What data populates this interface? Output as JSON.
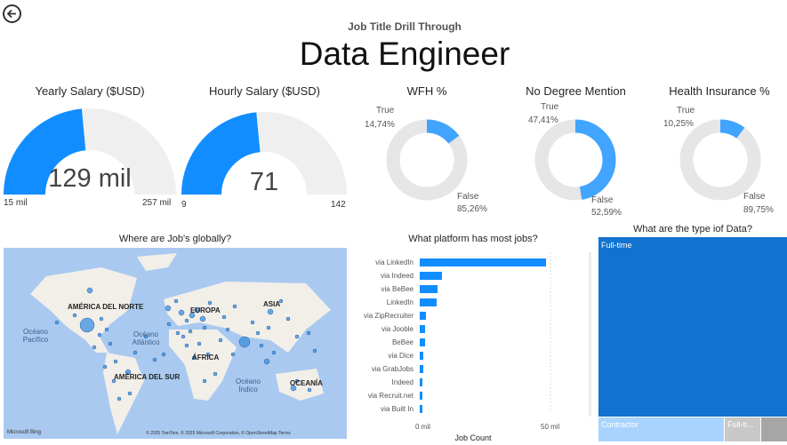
{
  "header": {
    "back_icon": "back-arrow-icon",
    "subtitle": "Job Title Drill Through",
    "title": "Data Engineer"
  },
  "gauges": [
    {
      "title": "Yearly Salary ($USD)",
      "value_label": "129 mil",
      "min_label": "15 mil",
      "max_label": "257 mil",
      "fraction": 0.47,
      "color": "#118DFF"
    },
    {
      "title": "Hourly Salary ($USD)",
      "value_label": "71",
      "min_label": "9",
      "max_label": "142",
      "fraction": 0.47,
      "color": "#118DFF"
    }
  ],
  "donuts": [
    {
      "title": "WFH %",
      "true_label": "True",
      "true_value": "14,74%",
      "false_label": "False",
      "false_value": "85,26%",
      "true_fraction": 0.1474
    },
    {
      "title": "No Degree Mention",
      "true_label": "True",
      "true_value": "47,41%",
      "false_label": "False",
      "false_value": "52,59%",
      "true_fraction": 0.4741
    },
    {
      "title": "Health Insurance %",
      "true_label": "True",
      "true_value": "10,25%",
      "false_label": "False",
      "false_value": "89,75%",
      "true_fraction": 0.1025
    }
  ],
  "map": {
    "title": "Where are Job's globally?",
    "continents": [
      "AMÉRICA DEL NORTE",
      "EUROPA",
      "ASIA",
      "ÁFRICA",
      "AMÉRICA DEL SUR",
      "OCEANÍA"
    ],
    "oceans": [
      "Océano Pacífico",
      "Océano Atlántico",
      "Océano Índico"
    ],
    "logo_text": "Microsoft Bing",
    "attribution": "© 2025 TomTom, © 2025 Microsoft Corporation, © OpenStreetMap  Terms"
  },
  "chart_data": {
    "type": "bar",
    "title": "What platform has most jobs?",
    "xlabel": "Job Count",
    "x_ticks": [
      "0 mil",
      "50 mil"
    ],
    "xlim": [
      0,
      60
    ],
    "categories": [
      "via LinkedIn",
      "via Indeed",
      "via BeBee",
      "LinkedIn",
      "via ZipRecruiter",
      "via Jooble",
      "BeBee",
      "via Dice",
      "via GrabJobs",
      "Indeed",
      "via Recruit.net",
      "via Built In"
    ],
    "values": [
      49,
      8.5,
      7,
      6.5,
      2.5,
      2.2,
      2.2,
      1.5,
      1.3,
      1.2,
      1.0,
      1.0
    ],
    "color": "#118DFF"
  },
  "treemap": {
    "title": "What are the type iof Data?",
    "items": [
      {
        "label": "Full-time",
        "color": "#1172CF"
      },
      {
        "label": "Contractor",
        "color": "#A9D3FF"
      },
      {
        "label": "Full-ti...",
        "color": "#C8C8C8"
      },
      {
        "label": "",
        "color": "#A6A6A6"
      }
    ]
  }
}
